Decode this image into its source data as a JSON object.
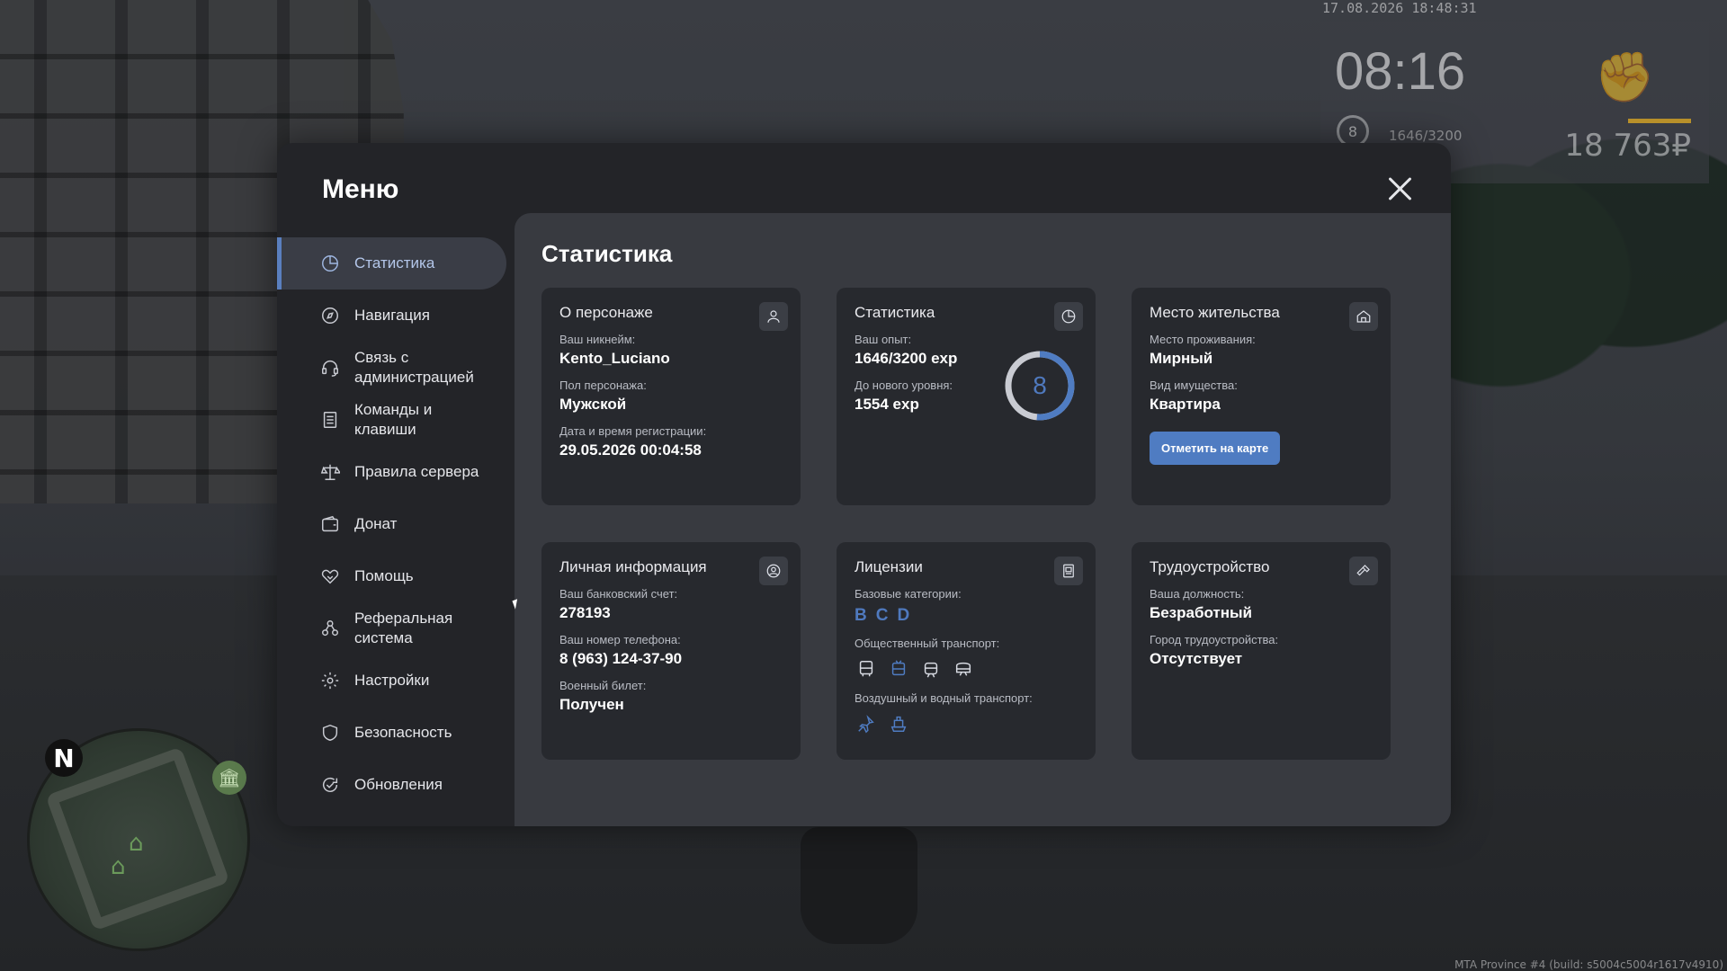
{
  "hud": {
    "timestamp": "17.08.2026 18:48:31",
    "clock": "08:16",
    "level": "8",
    "exp": "1646/3200",
    "money": "18 763₽"
  },
  "build_info": "MTA Province #4 (build: s5004c5004r1617v4910)",
  "minimap": {
    "north": "N"
  },
  "menu": {
    "title": "Меню",
    "sidebar": [
      {
        "label": "Статистика",
        "icon": "pie-chart-icon"
      },
      {
        "label": "Навигация",
        "icon": "compass-icon"
      },
      {
        "label": "Связь с администрацией",
        "icon": "headset-icon"
      },
      {
        "label": "Команды и клавиши",
        "icon": "document-icon"
      },
      {
        "label": "Правила сервера",
        "icon": "scales-icon"
      },
      {
        "label": "Донат",
        "icon": "wallet-icon"
      },
      {
        "label": "Помощь",
        "icon": "handshake-icon"
      },
      {
        "label": "Реферальная система",
        "icon": "people-icon"
      },
      {
        "label": "Настройки",
        "icon": "gear-icon"
      },
      {
        "label": "Безопасность",
        "icon": "shield-icon"
      },
      {
        "label": "Обновления",
        "icon": "refresh-check-icon"
      }
    ],
    "active_item": "Статистика"
  },
  "content": {
    "title": "Статистика",
    "character": {
      "title": "О персонаже",
      "nickname_label": "Ваш никнейм:",
      "nickname": "Kento_Luciano",
      "gender_label": "Пол персонажа:",
      "gender": "Мужской",
      "reg_label": "Дата и время регистрации:",
      "reg": "29.05.2026 00:04:58"
    },
    "stats": {
      "title": "Статистика",
      "exp_label": "Ваш опыт:",
      "exp": "1646/3200 exp",
      "next_label": "До нового уровня:",
      "next": "1554 exp",
      "level": "8",
      "progress": 0.514
    },
    "residence": {
      "title": "Место жительства",
      "place_label": "Место проживания:",
      "place": "Мирный",
      "property_label": "Вид имущества:",
      "property": "Квартира",
      "map_button": "Отметить на карте"
    },
    "personal": {
      "title": "Личная информация",
      "bank_label": "Ваш банковский счет:",
      "bank": "278193",
      "phone_label": "Ваш номер телефона:",
      "phone": "8 (963) 124-37-90",
      "military_label": "Военный билет:",
      "military": "Получен"
    },
    "licenses": {
      "title": "Лицензии",
      "base_label": "Базовые категории:",
      "categories": [
        "B",
        "C",
        "D"
      ],
      "public_label": "Общественный транспорт:",
      "public_icons": [
        "bus-icon",
        "trolleybus-icon",
        "tram-icon",
        "metro-icon"
      ],
      "air_label": "Воздушный и водный транспорт:",
      "air_icons": [
        "plane-icon",
        "boat-icon"
      ]
    },
    "employment": {
      "title": "Трудоустройство",
      "position_label": "Ваша должность:",
      "position": "Безработный",
      "city_label": "Город трудоустройства:",
      "city": "Отсутствует"
    }
  }
}
